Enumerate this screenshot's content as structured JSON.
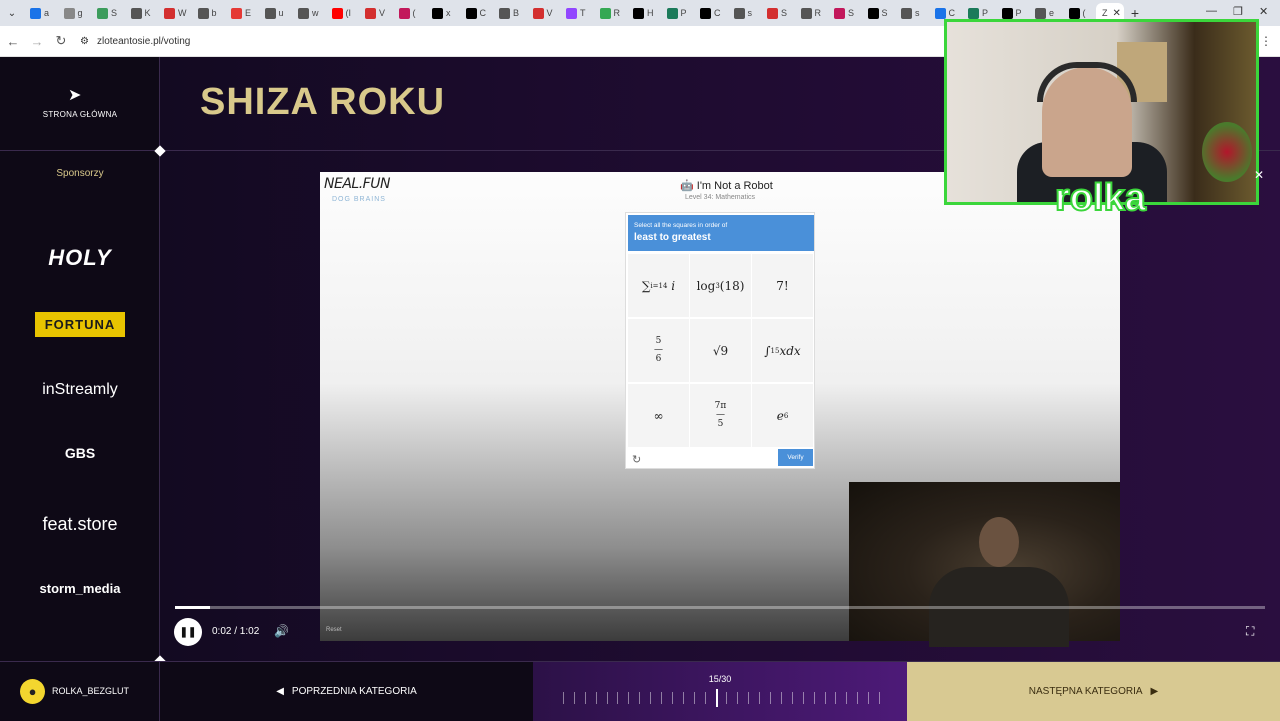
{
  "browser": {
    "tabs": [
      {
        "label": "a",
        "color": "#1a73e8"
      },
      {
        "label": "g",
        "color": "#888"
      },
      {
        "label": "S",
        "color": "#3c9c5c"
      },
      {
        "label": "K",
        "color": "#555"
      },
      {
        "label": "W",
        "color": "#d32f2f"
      },
      {
        "label": "b",
        "color": "#555"
      },
      {
        "label": "E",
        "color": "#e53935"
      },
      {
        "label": "u",
        "color": "#555"
      },
      {
        "label": "w",
        "color": "#555"
      },
      {
        "label": "(I",
        "color": "#ff0000"
      },
      {
        "label": "V",
        "color": "#d32f2f"
      },
      {
        "label": "(",
        "color": "#c2185b"
      },
      {
        "label": "x",
        "color": "#000"
      },
      {
        "label": "C",
        "color": "#000"
      },
      {
        "label": "B",
        "color": "#555"
      },
      {
        "label": "V",
        "color": "#d32f2f"
      },
      {
        "label": "T",
        "color": "#9146ff"
      },
      {
        "label": "R",
        "color": "#34a853"
      },
      {
        "label": "H",
        "color": "#000"
      },
      {
        "label": "P",
        "color": "#1b7a5a"
      },
      {
        "label": "C",
        "color": "#000"
      },
      {
        "label": "s",
        "color": "#555"
      },
      {
        "label": "S",
        "color": "#d32f2f"
      },
      {
        "label": "R",
        "color": "#555"
      },
      {
        "label": "S",
        "color": "#c2185b"
      },
      {
        "label": "S",
        "color": "#000"
      },
      {
        "label": "s",
        "color": "#555"
      },
      {
        "label": "C",
        "color": "#1a73e8"
      },
      {
        "label": "P",
        "color": "#1b7a5a"
      },
      {
        "label": "P",
        "color": "#000"
      },
      {
        "label": "e",
        "color": "#555"
      },
      {
        "label": "(",
        "color": "#000"
      }
    ],
    "active_tab": "Z",
    "url": "zloteantosie.pl/voting"
  },
  "sidebar": {
    "home_label": "STRONA GŁÓWNA",
    "sponsors_title": "Sponsorzy",
    "sponsors": [
      "HOLY",
      "FORTUNA",
      "inStreamly",
      "GBS",
      "feat.store",
      "storm_media"
    ]
  },
  "page": {
    "title": "SHIZA ROKU"
  },
  "video": {
    "site_logo": "NEAL.FUN",
    "site_sub": "DOG BRAINS",
    "game_title": "I'm Not a Robot",
    "game_level": "Level 34: Mathematics",
    "captcha_instruction": "Select all the squares in order of",
    "captcha_main": "least to greatest",
    "verify_label": "Verify",
    "reset_label": "Reset",
    "time": "0:02 / 1:02",
    "progress": 0.032
  },
  "bottom": {
    "username": "ROLKA_BEZGLUT",
    "prev_label": "POPRZEDNIA KATEGORIA",
    "counter": "15/30",
    "current_category": 15,
    "total_categories": 30,
    "next_label": "NASTĘPNA KATEGORIA"
  },
  "overlay": {
    "cam_label": "rolka"
  }
}
